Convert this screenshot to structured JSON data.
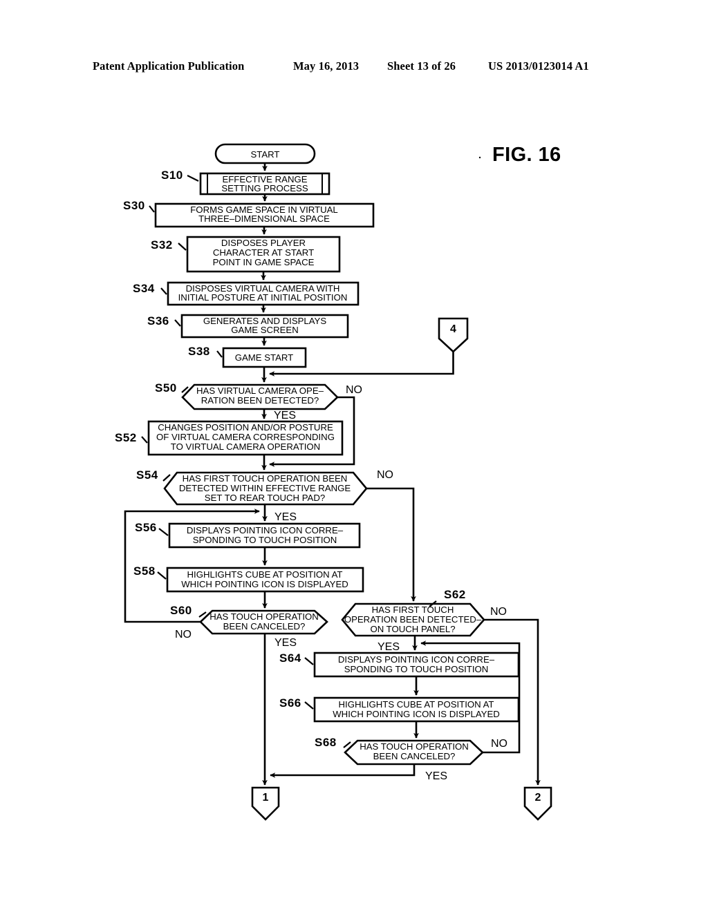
{
  "header": {
    "publication": "Patent Application Publication",
    "date": "May 16, 2013",
    "sheet": "Sheet 13 of 26",
    "patent_number": "US 2013/0123014 A1"
  },
  "figure": {
    "label": "FIG. 16"
  },
  "chart_data": {
    "type": "diagram",
    "title": "FIG. 16",
    "diagram_kind": "flowchart",
    "nodes": [
      {
        "id": "start",
        "step": "",
        "shape": "terminator",
        "text": "START"
      },
      {
        "id": "s10",
        "step": "S10",
        "shape": "predefined-process",
        "text": "EFFECTIVE RANGE\nSETTING PROCESS"
      },
      {
        "id": "s30",
        "step": "S30",
        "shape": "process",
        "text": "FORMS GAME SPACE IN VIRTUAL\nTHREE-DIMENSIONAL SPACE"
      },
      {
        "id": "s32",
        "step": "S32",
        "shape": "process",
        "text": "DISPOSES PLAYER\nCHARACTER AT START\nPOINT IN GAME SPACE"
      },
      {
        "id": "s34",
        "step": "S34",
        "shape": "process",
        "text": "DISPOSES VIRTUAL CAMERA WITH\nINITIAL POSTURE AT INITIAL POSITION"
      },
      {
        "id": "s36",
        "step": "S36",
        "shape": "process",
        "text": "GENERATES AND DISPLAYS\nGAME SCREEN"
      },
      {
        "id": "s38",
        "step": "S38",
        "shape": "process",
        "text": "GAME START"
      },
      {
        "id": "s50",
        "step": "S50",
        "shape": "decision",
        "text": "HAS VIRTUAL CAMERA OPE-\nRATION BEEN DETECTED?"
      },
      {
        "id": "s52",
        "step": "S52",
        "shape": "process",
        "text": "CHANGES POSITION AND/OR POSTURE\nOF VIRTUAL CAMERA CORRESPONDING\nTO VIRTUAL CAMERA OPERATION"
      },
      {
        "id": "s54",
        "step": "S54",
        "shape": "decision",
        "text": "HAS FIRST TOUCH OPERATION BEEN\nDETECTED WITHIN EFFECTIVE RANGE\nSET TO REAR TOUCH PAD?"
      },
      {
        "id": "s56",
        "step": "S56",
        "shape": "process",
        "text": "DISPLAYS POINTING ICON CORRE-\nSPONDING TO TOUCH POSITION"
      },
      {
        "id": "s58",
        "step": "S58",
        "shape": "process",
        "text": "HIGHLIGHTS CUBE AT POSITION AT\nWHICH POINTING ICON IS DISPLAYED"
      },
      {
        "id": "s60",
        "step": "S60",
        "shape": "decision",
        "text": "HAS TOUCH OPERATION\nBEEN CANCELED?"
      },
      {
        "id": "s62",
        "step": "S62",
        "shape": "decision",
        "text": "HAS FIRST TOUCH\nOPERATION BEEN DETECTED-\nON TOUCH PANEL?"
      },
      {
        "id": "s64",
        "step": "S64",
        "shape": "process",
        "text": "DISPLAYS POINTING ICON CORRE-\nSPONDING TO TOUCH POSITION"
      },
      {
        "id": "s66",
        "step": "S66",
        "shape": "process",
        "text": "HIGHLIGHTS CUBE AT POSITION AT\nWHICH POINTING ICON IS DISPLAYED"
      },
      {
        "id": "s68",
        "step": "S68",
        "shape": "decision",
        "text": "HAS TOUCH OPERATION\nBEEN CANCELED?"
      },
      {
        "id": "conn4",
        "step": "",
        "shape": "offpage-connector",
        "text": "4"
      },
      {
        "id": "conn1",
        "step": "",
        "shape": "offpage-connector",
        "text": "1"
      },
      {
        "id": "conn2",
        "step": "",
        "shape": "offpage-connector",
        "text": "2"
      }
    ],
    "edge_labels": [
      {
        "id": "s50-no",
        "text": "NO"
      },
      {
        "id": "s50-yes",
        "text": "YES"
      },
      {
        "id": "s54-no",
        "text": "NO"
      },
      {
        "id": "s54-yes",
        "text": "YES"
      },
      {
        "id": "s60-no",
        "text": "NO"
      },
      {
        "id": "s60-yes",
        "text": "YES"
      },
      {
        "id": "s62-no",
        "text": "NO"
      },
      {
        "id": "s62-yes",
        "text": "YES"
      },
      {
        "id": "s68-no",
        "text": "NO"
      },
      {
        "id": "s68-yes",
        "text": "YES"
      }
    ],
    "step_labels": [
      "S10",
      "S30",
      "S32",
      "S34",
      "S36",
      "S38",
      "S50",
      "S52",
      "S54",
      "S56",
      "S58",
      "S60",
      "S62",
      "S64",
      "S66",
      "S68"
    ],
    "connector_labels": [
      "4",
      "1",
      "2"
    ],
    "colors": {
      "line": "#000000",
      "fill": "#ffffff",
      "text": "#000000"
    }
  }
}
